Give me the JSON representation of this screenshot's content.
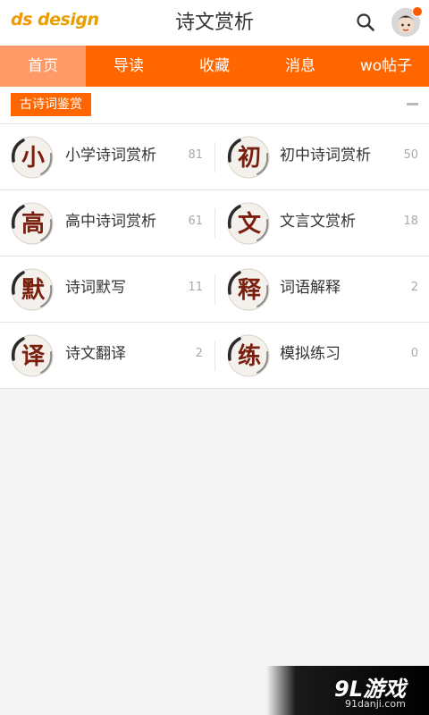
{
  "header": {
    "logo_part1": "ds",
    "logo_part2": " design",
    "title": "诗文赏析"
  },
  "tabs": [
    {
      "label": "首页",
      "active": true
    },
    {
      "label": "导读",
      "active": false
    },
    {
      "label": "收藏",
      "active": false
    },
    {
      "label": "消息",
      "active": false
    },
    {
      "label": "wo帖子",
      "active": false
    }
  ],
  "section": {
    "tag": "古诗词鉴赏"
  },
  "items": [
    {
      "glyph": "小",
      "label": "小学诗词赏析",
      "count": "81"
    },
    {
      "glyph": "初",
      "label": "初中诗词赏析",
      "count": "50"
    },
    {
      "glyph": "高",
      "label": "高中诗词赏析",
      "count": "61"
    },
    {
      "glyph": "文",
      "label": "文言文赏析",
      "count": "18"
    },
    {
      "glyph": "默",
      "label": "诗词默写",
      "count": "11"
    },
    {
      "glyph": "释",
      "label": "词语解释",
      "count": "2"
    },
    {
      "glyph": "译",
      "label": "诗文翻译",
      "count": "2"
    },
    {
      "glyph": "练",
      "label": "模拟练习",
      "count": "0"
    }
  ],
  "watermark": {
    "main": "9L游戏",
    "sub": "91danji.com"
  },
  "colors": {
    "accent": "#ff6600",
    "tab_active": "#ff9966",
    "notification": "#ff5a00",
    "badge_glyph": "#7a1e0e"
  }
}
